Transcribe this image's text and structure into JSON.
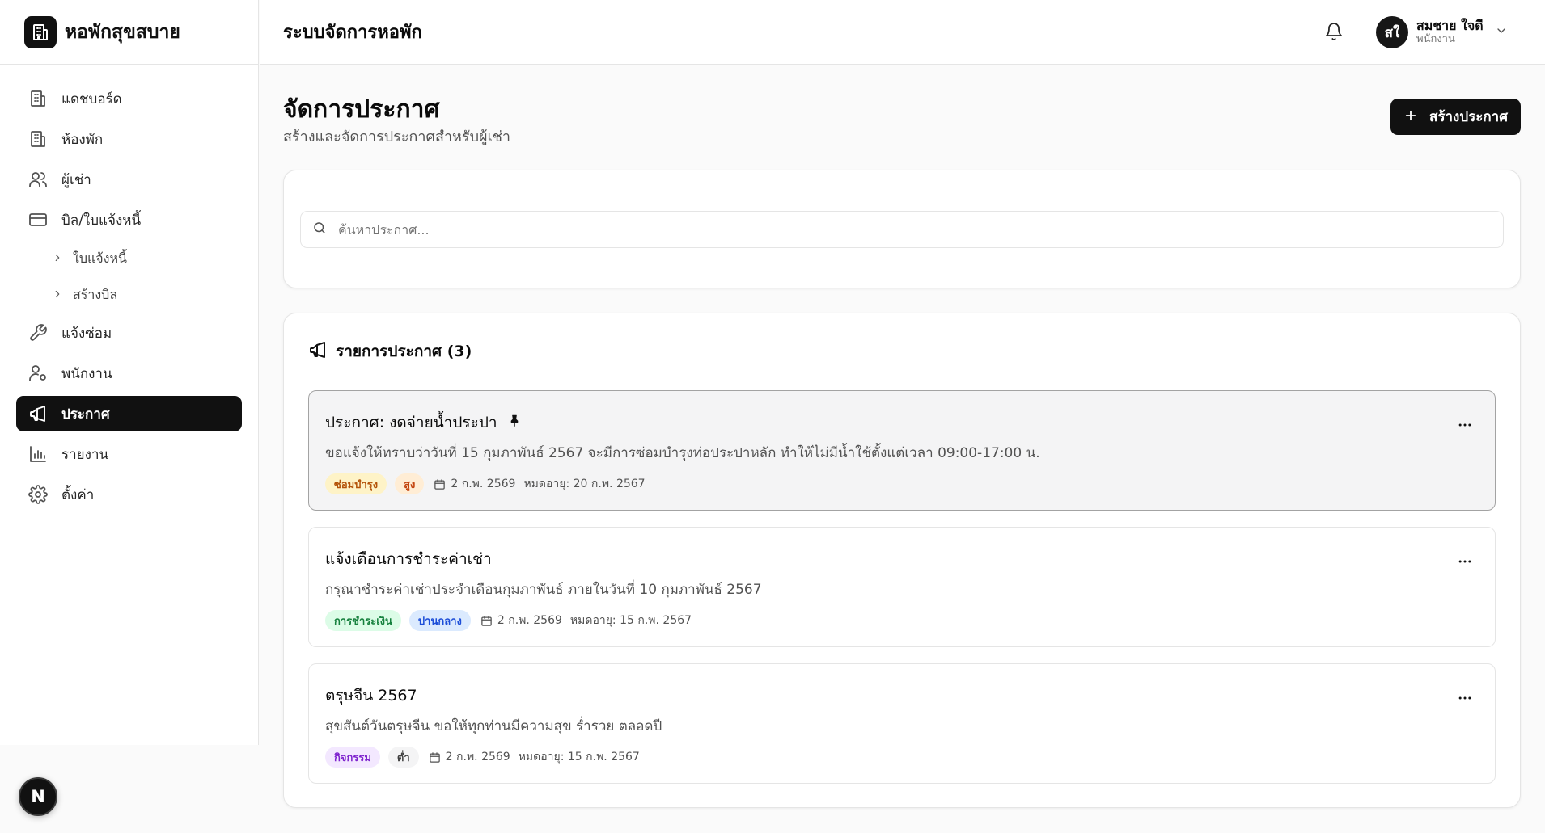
{
  "app": {
    "name": "หอพักสุขสบาย",
    "header_title": "ระบบจัดการหอพัก"
  },
  "user": {
    "initials": "สใ",
    "name": "สมชาย ใจดี",
    "role": "พนักงาน"
  },
  "nav": {
    "items": [
      {
        "label": "แดชบอร์ด",
        "icon": "building-icon"
      },
      {
        "label": "ห้องพัก",
        "icon": "building-icon"
      },
      {
        "label": "ผู้เช่า",
        "icon": "users-icon"
      },
      {
        "label": "บิล/ใบแจ้งหนี้",
        "icon": "credit-card-icon"
      },
      {
        "label": "แจ้งซ่อม",
        "icon": "wrench-icon"
      },
      {
        "label": "พนักงาน",
        "icon": "user-cog-icon"
      },
      {
        "label": "ประกาศ",
        "icon": "megaphone-icon",
        "active": true
      },
      {
        "label": "รายงาน",
        "icon": "bar-chart-icon"
      },
      {
        "label": "ตั้งค่า",
        "icon": "gear-icon"
      }
    ],
    "sub_items": [
      {
        "label": "ใบแจ้งหนี้"
      },
      {
        "label": "สร้างบิล"
      }
    ]
  },
  "page": {
    "title": "จัดการประกาศ",
    "subtitle": "สร้างและจัดการประกาศสำหรับผู้เช่า",
    "create_button": "สร้างประกาศ"
  },
  "search": {
    "placeholder": "ค้นหาประกาศ..."
  },
  "list": {
    "heading": "รายการประกาศ (3)",
    "items": [
      {
        "title": "ประกาศ: งดจ่ายน้ำประปา",
        "pinned": true,
        "body": "ขอแจ้งให้ทราบว่าวันที่ 15 กุมภาพันธ์ 2567 จะมีการซ่อมบำรุงท่อประปาหลัก ทำให้ไม่มีน้ำใช้ตั้งแต่เวลา 09:00-17:00 น.",
        "category": "ซ่อมบำรุง",
        "priority": "สูง",
        "date": "2 ก.พ. 2569",
        "expires": "หมดอายุ: 20 ก.พ. 2567"
      },
      {
        "title": "แจ้งเตือนการชำระค่าเช่า",
        "pinned": false,
        "body": "กรุณาชำระค่าเช่าประจำเดือนกุมภาพันธ์ ภายในวันที่ 10 กุมภาพันธ์ 2567",
        "category": "การชำระเงิน",
        "priority": "ปานกลาง",
        "date": "2 ก.พ. 2569",
        "expires": "หมดอายุ: 15 ก.พ. 2567"
      },
      {
        "title": "ตรุษจีน 2567",
        "pinned": false,
        "body": "สุขสันต์วันตรุษจีน ขอให้ทุกท่านมีความสุข ร่ำรวย ตลอดปี",
        "category": "กิจกรรม",
        "priority": "ต่ำ",
        "date": "2 ก.พ. 2569",
        "expires": "หมดอายุ: 15 ก.พ. 2567"
      }
    ]
  },
  "colors": {
    "primary": "#111111",
    "tag_maintenance_bg": "#fef3c7",
    "tag_maintenance_fg": "#b45309",
    "tag_high_bg": "#ffedd5",
    "tag_high_fg": "#c2410c",
    "tag_payment_bg": "#dcfce7",
    "tag_payment_fg": "#15803d",
    "tag_medium_bg": "#dbeafe",
    "tag_medium_fg": "#1d4ed8",
    "tag_activity_bg": "#f3e8ff",
    "tag_activity_fg": "#7e22ce",
    "tag_low_bg": "#f4f4f5",
    "tag_low_fg": "#404040"
  },
  "devtools": {
    "label": "N"
  }
}
